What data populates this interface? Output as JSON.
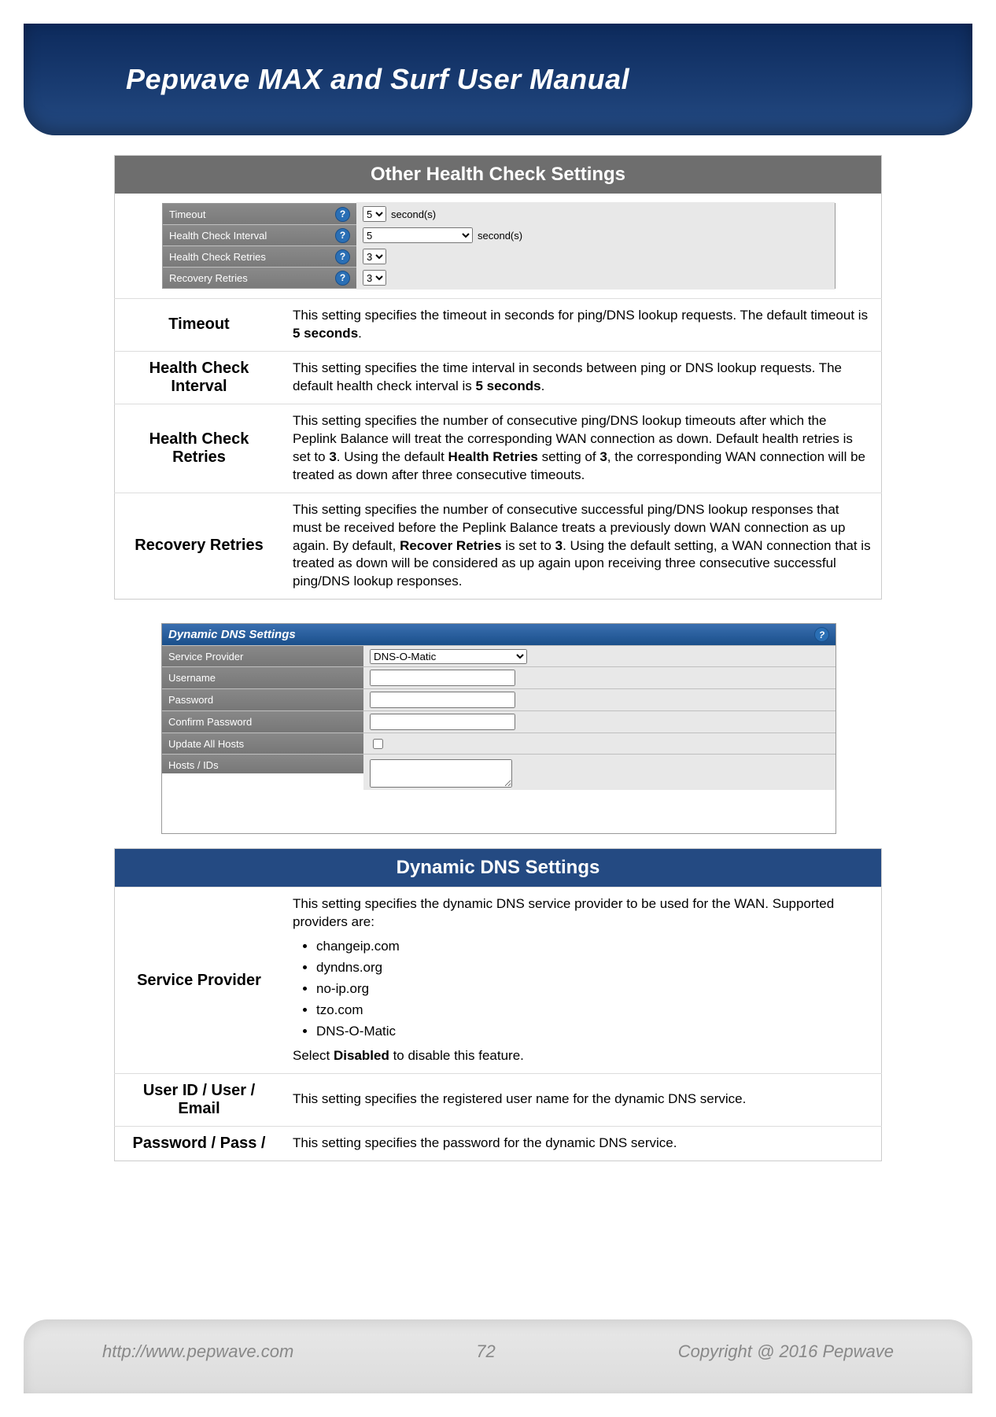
{
  "header": {
    "title": "Pepwave MAX and Surf User Manual"
  },
  "section1": {
    "title": "Other Health Check Settings",
    "ui_rows": {
      "timeout_label": "Timeout",
      "timeout_value": "5",
      "timeout_unit": "second(s)",
      "interval_label": "Health Check Interval",
      "interval_value": "5",
      "interval_unit": "second(s)",
      "retries_label": "Health Check Retries",
      "retries_value": "3",
      "recovery_label": "Recovery Retries",
      "recovery_value": "3"
    },
    "rows": {
      "timeout": {
        "label": "Timeout",
        "text_a": "This setting specifies the timeout in seconds for ping/DNS lookup requests. The default timeout is ",
        "text_b": "5 seconds",
        "text_c": "."
      },
      "interval": {
        "label": "Health Check Interval",
        "text_a": "This setting specifies the time interval in seconds between ping or DNS lookup requests. The default health check interval is ",
        "text_b": "5 seconds",
        "text_c": "."
      },
      "retries": {
        "label": "Health Check Retries",
        "text_a": "This setting specifies the number of consecutive ping/DNS lookup timeouts after which the Peplink Balance will treat the corresponding WAN connection as down. Default health retries is set to ",
        "text_b": "3",
        "text_c": ". Using the default ",
        "text_d": "Health Retries",
        "text_e": " setting of ",
        "text_f": "3",
        "text_g": ", the corresponding WAN connection will be treated as down after three consecutive  timeouts."
      },
      "recovery": {
        "label": "Recovery Retries",
        "text_a": "This setting specifies the number of consecutive successful ping/DNS lookup responses that must be received before the Peplink Balance treats a previously down WAN connection as up again. By default, ",
        "text_b": "Recover Retries",
        "text_c": " is set to ",
        "text_d": "3",
        "text_e": ". Using the default setting, a WAN connection that is treated as down will be considered as up again upon receiving three consecutive successful ping/DNS lookup responses."
      }
    }
  },
  "ddns_card": {
    "title": "Dynamic DNS Settings",
    "rows": {
      "provider_label": "Service Provider",
      "provider_value": "DNS-O-Matic",
      "username_label": "Username",
      "password_label": "Password",
      "confirm_label": "Confirm Password",
      "update_label": "Update All Hosts",
      "hosts_label": "Hosts / IDs"
    }
  },
  "section2": {
    "title": "Dynamic DNS Settings",
    "rows": {
      "provider": {
        "label": "Service Provider",
        "intro": "This setting specifies the dynamic DNS service provider to be used for the WAN. Supported providers are:",
        "items": [
          "changeip.com",
          "dyndns.org",
          "no-ip.org",
          "tzo.com",
          "DNS-O-Matic"
        ],
        "outro_a": "Select ",
        "outro_b": "Disabled",
        "outro_c": " to disable this feature."
      },
      "userid": {
        "label": "User ID / User / Email",
        "text": "This setting specifies the registered user name for the dynamic DNS service."
      },
      "password": {
        "label": "Password / Pass /",
        "text": "This setting specifies the password for the dynamic DNS service."
      }
    }
  },
  "footer": {
    "url": "http://www.pepwave.com",
    "page": "72",
    "copyright": "Copyright @ 2016 Pepwave"
  }
}
